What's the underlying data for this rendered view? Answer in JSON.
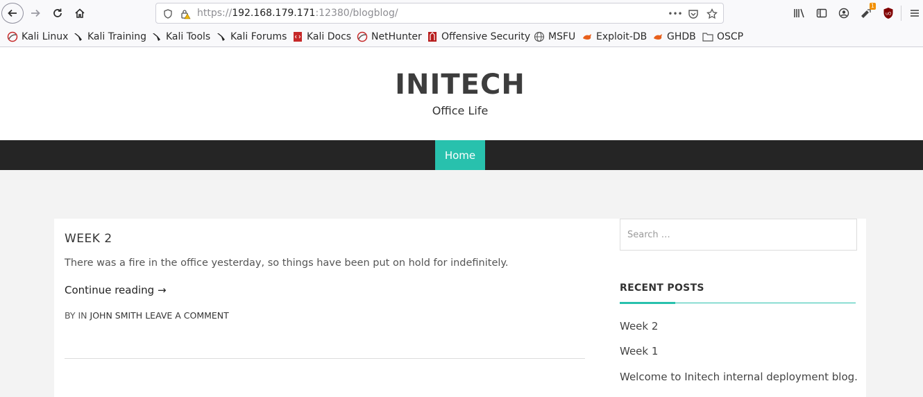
{
  "browser": {
    "url_prefix": "https://",
    "url_host": "192.168.179.171",
    "url_rest": ":12380/blogblog/",
    "menu_dots": "•••",
    "addon_badge": "1"
  },
  "bookmarks": [
    {
      "label": "Kali Linux",
      "icon": "kali-dragon-icon"
    },
    {
      "label": "Kali Training",
      "icon": "kali-dragon-icon"
    },
    {
      "label": "Kali Tools",
      "icon": "kali-dragon-icon"
    },
    {
      "label": "Kali Forums",
      "icon": "kali-dragon-icon"
    },
    {
      "label": "Kali Docs",
      "icon": "kali-docs-icon"
    },
    {
      "label": "NetHunter",
      "icon": "kali-dragon-icon"
    },
    {
      "label": "Offensive Security",
      "icon": "offsec-icon"
    },
    {
      "label": "MSFU",
      "icon": "globe-icon"
    },
    {
      "label": "Exploit-DB",
      "icon": "exploit-db-icon"
    },
    {
      "label": "GHDB",
      "icon": "exploit-db-icon"
    },
    {
      "label": "OSCP",
      "icon": "folder-icon"
    }
  ],
  "site": {
    "title": "INITECH",
    "tagline": "Office Life"
  },
  "nav": {
    "home": "Home"
  },
  "post": {
    "title": "WEEK 2",
    "excerpt": "There was a fire in the office yesterday, so things have been put on hold for indefinitely.",
    "continue": "Continue reading →",
    "meta_prefix": "BY  IN ",
    "meta_author": "JOHN SMITH",
    "meta_comment": "LEAVE A COMMENT"
  },
  "sidebar": {
    "search_placeholder": "Search …",
    "recent_title": "RECENT POSTS",
    "recent_posts": [
      "Week 2",
      "Week 1",
      "Welcome to Initech internal deployment blog."
    ]
  },
  "colors": {
    "accent": "#28c1ad",
    "nav_bg": "#252525"
  }
}
